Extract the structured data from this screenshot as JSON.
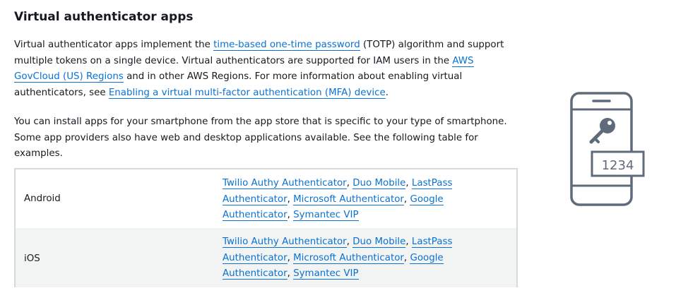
{
  "heading": "Virtual authenticator apps",
  "para1": {
    "t1": "Virtual authenticator apps implement the ",
    "link_totp": "time-based one-time password",
    "t2": " (TOTP) algorithm and support multiple tokens on a single device. Virtual authenticators are supported for IAM users in the ",
    "link_govcloud": "AWS GovCloud (US) Regions",
    "t3": " and in other AWS Regions. For more information about enabling virtual authenticators, see ",
    "link_enable_mfa": "Enabling a virtual multi-factor authentication (MFA) device",
    "t4": "."
  },
  "para2": "You can install apps for your smartphone from the app store that is specific to your type of smartphone. Some app providers also have web and desktop applications available. See the following table for examples.",
  "table": {
    "rows": [
      {
        "os": "Android",
        "apps": [
          "Twilio Authy Authenticator",
          "Duo Mobile",
          "LastPass Authenticator",
          "Microsoft Authenticator",
          "Google Authenticator",
          "Symantec VIP"
        ]
      },
      {
        "os": "iOS",
        "apps": [
          "Twilio Authy Authenticator",
          "Duo Mobile",
          "LastPass Authenticator",
          "Microsoft Authenticator",
          "Google Authenticator",
          "Symantec VIP"
        ]
      }
    ],
    "separator": ", "
  },
  "illustration": {
    "code": "1234",
    "stroke_color": "#5f6b7a",
    "icon": "phone-key-icon"
  },
  "colors": {
    "link": "#0972d3",
    "text": "#16191f",
    "table_border": "#d5dbdb",
    "row_alt": "#f2f3f3"
  }
}
